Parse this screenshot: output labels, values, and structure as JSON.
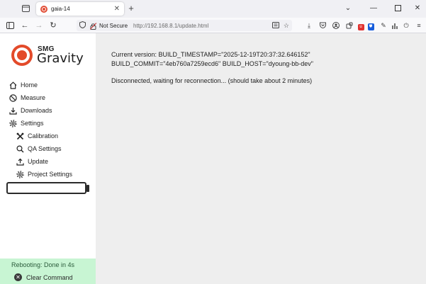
{
  "browser": {
    "tab_title": "gaia-14",
    "new_tab_label": "+",
    "not_secure_label": "Not Secure",
    "url": "http://192.168.8.1/update.html"
  },
  "app": {
    "logo_brand": "SMG",
    "logo_name": "Gravity",
    "accent_color": "#e34a2a"
  },
  "sidebar": {
    "items": [
      {
        "label": "Home",
        "icon": "home-icon"
      },
      {
        "label": "Measure",
        "icon": "measure-icon"
      },
      {
        "label": "Downloads",
        "icon": "download-icon"
      },
      {
        "label": "Settings",
        "icon": "gear-icon"
      },
      {
        "label": "Calibration",
        "icon": "tools-icon"
      },
      {
        "label": "QA Settings",
        "icon": "search-icon"
      },
      {
        "label": "Update",
        "icon": "upload-icon"
      },
      {
        "label": "Project Settings",
        "icon": "gear-icon"
      }
    ],
    "command_input_value": ""
  },
  "status": {
    "message": "Rebooting: Done in 4s",
    "clear_label": "Clear Command",
    "background_color": "#c8f5d3"
  },
  "main": {
    "version_line": "Current version: BUILD_TIMESTAMP=\"2025-12-19T20:37:32.646152\" BUILD_COMMIT=\"4eb760a7259ecd6\" BUILD_HOST=\"dyoung-bb-dev\"",
    "reconnect_line": "Disconnected, waiting for reconnection... (should take about 2 minutes)"
  }
}
